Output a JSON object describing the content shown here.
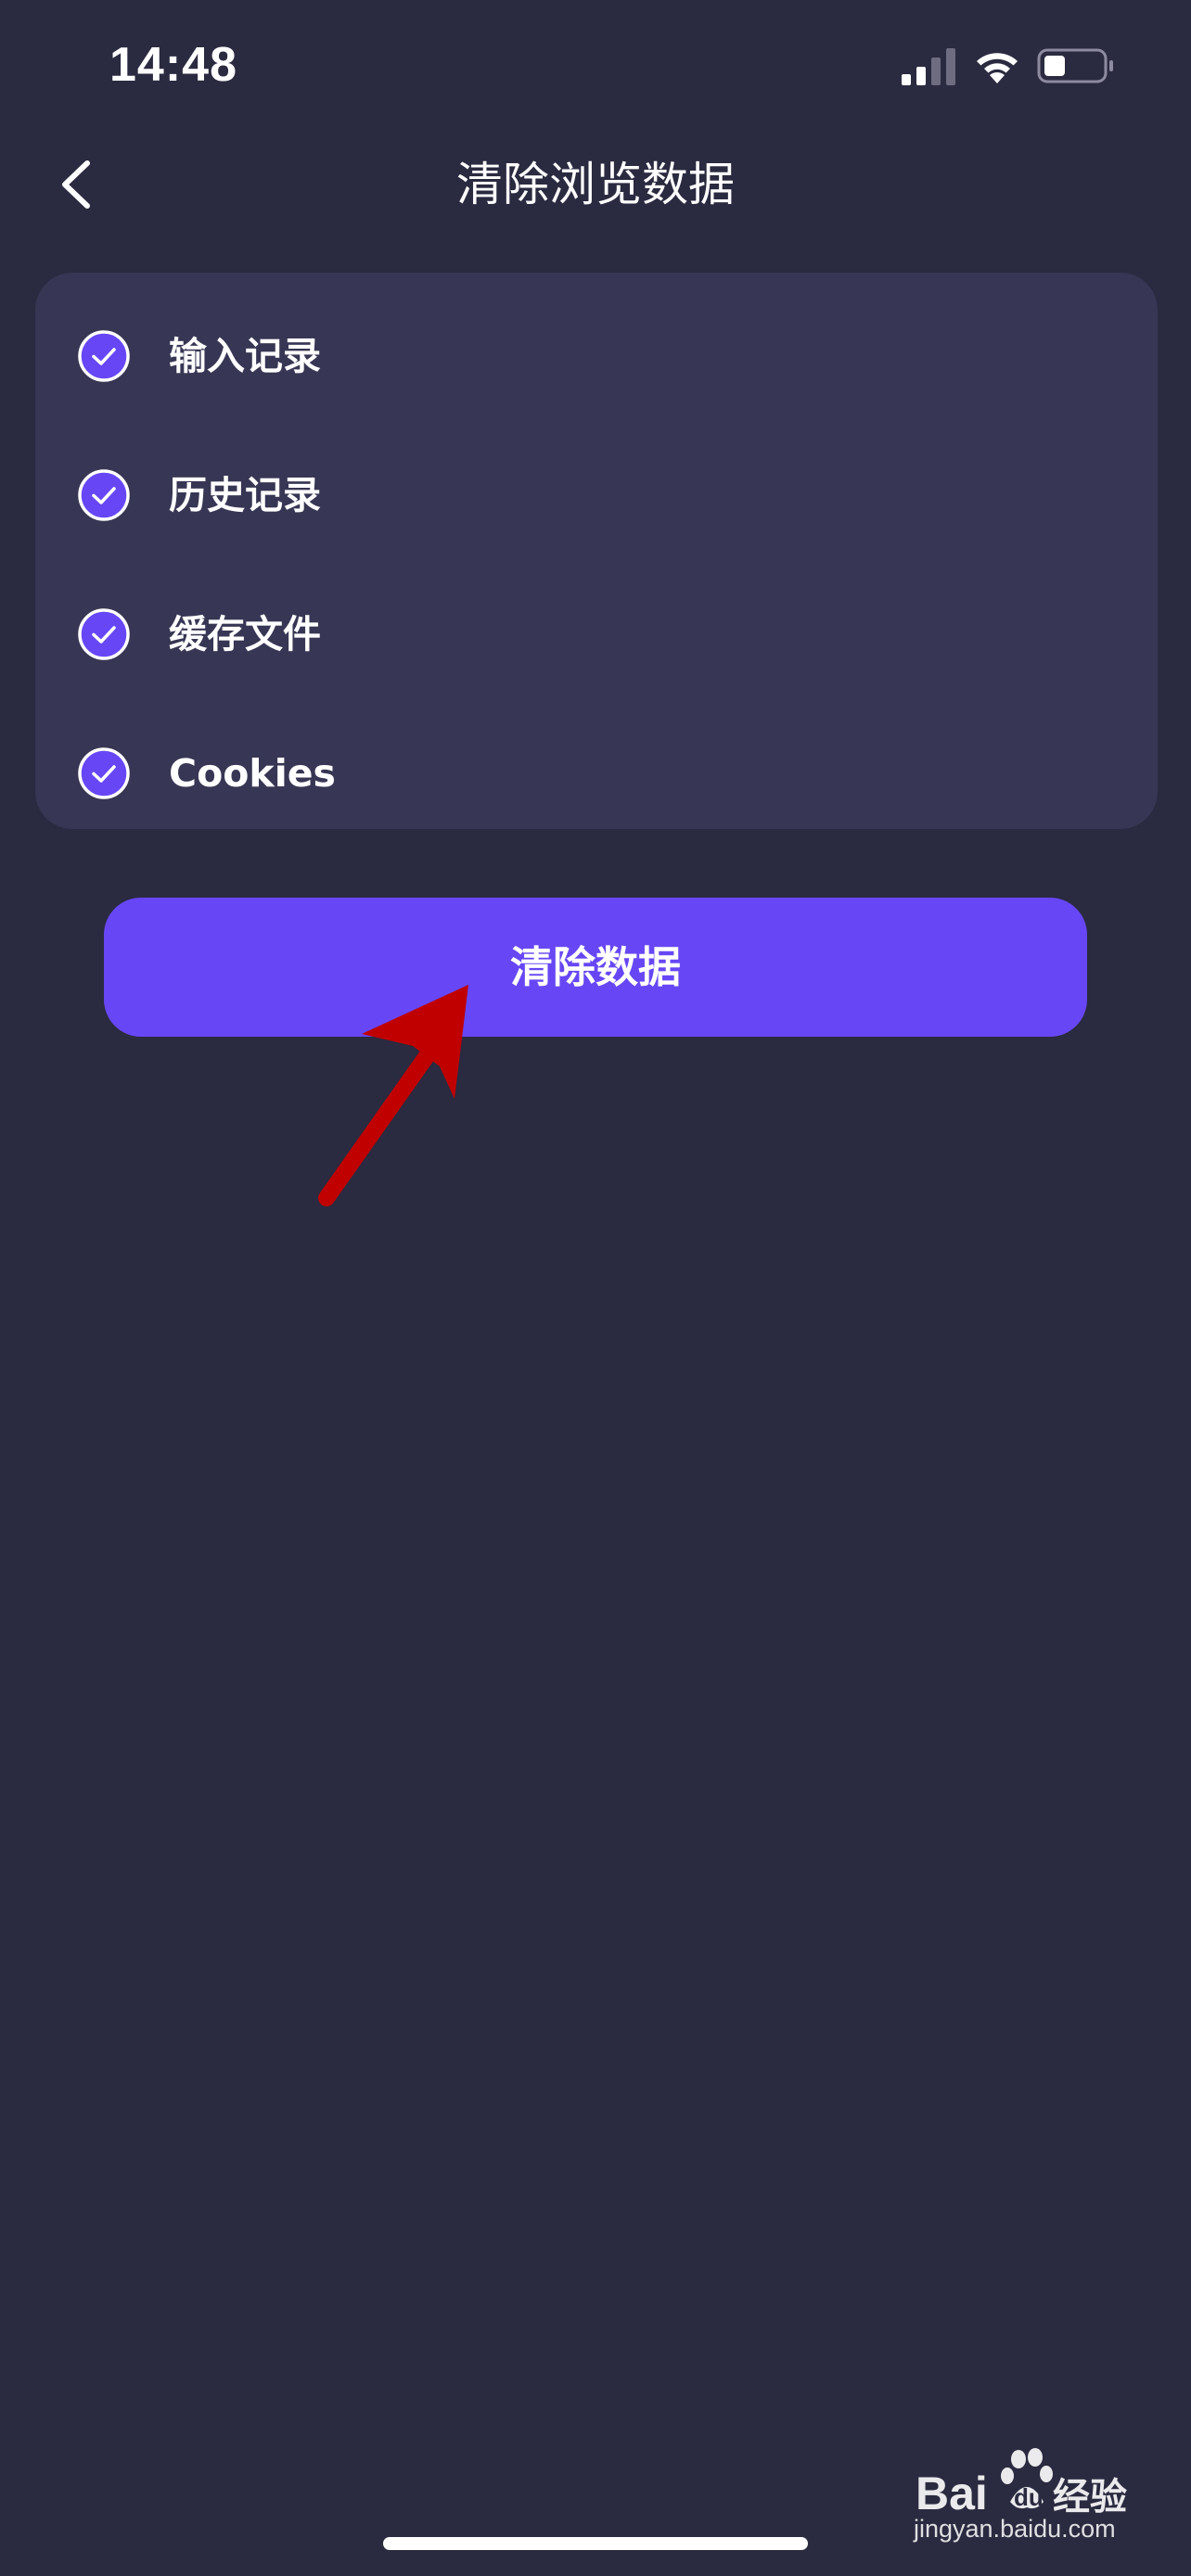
{
  "status_bar": {
    "time": "14:48"
  },
  "header": {
    "title": "清除浏览数据",
    "back_icon": "chevron-left-icon"
  },
  "options": [
    {
      "label": "输入记录",
      "checked": true
    },
    {
      "label": "历史记录",
      "checked": true
    },
    {
      "label": "缓存文件",
      "checked": true
    },
    {
      "label": "Cookies",
      "checked": true
    }
  ],
  "primary_action": {
    "label": "清除数据"
  },
  "watermark": {
    "brand": "Bai du 经验",
    "caption": "jingyan.baidu.com"
  },
  "colors": {
    "background": "#2a2a40",
    "card": "#373654",
    "accent": "#6747f5",
    "annotation": "#c00000"
  }
}
